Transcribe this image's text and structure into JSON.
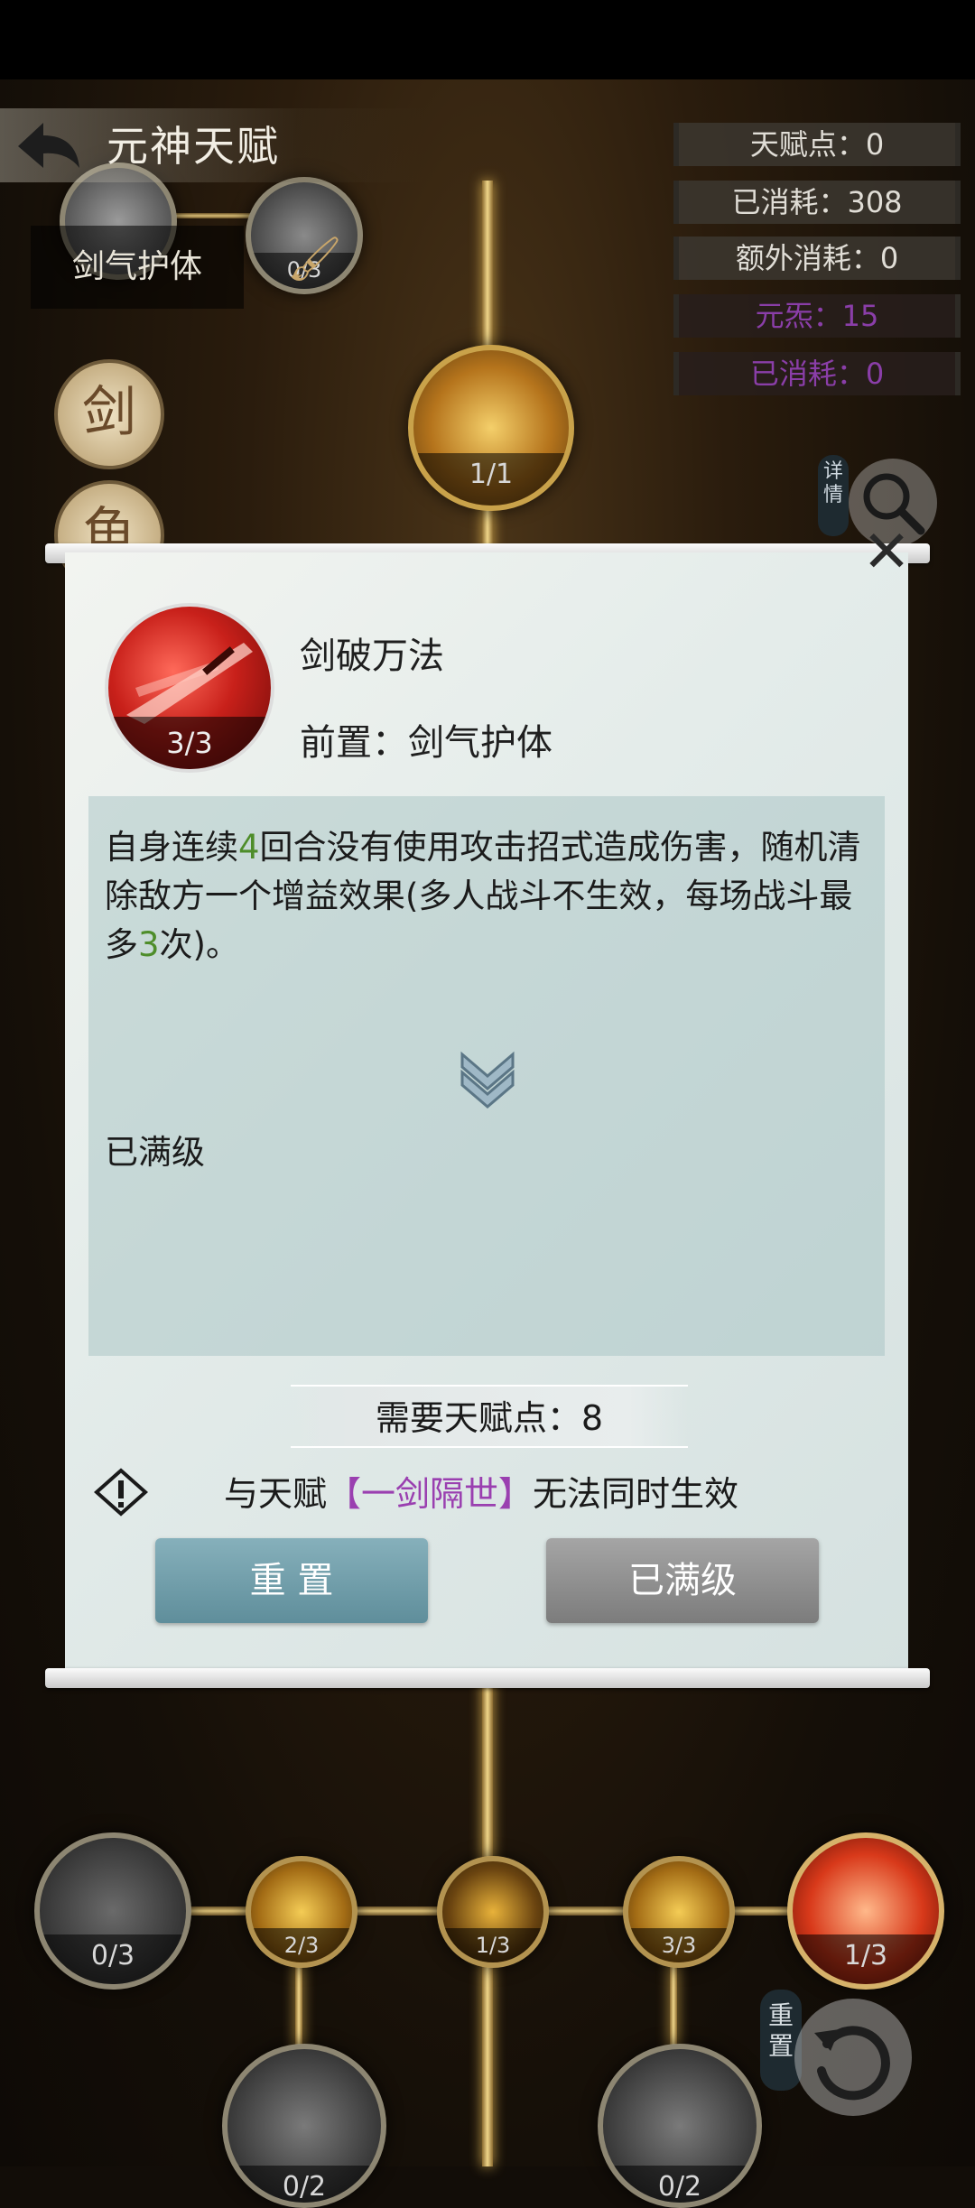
{
  "header": {
    "title": "元神天赋"
  },
  "stats": [
    {
      "label": "天赋点：0"
    },
    {
      "label": "已消耗：308"
    },
    {
      "label": "额外消耗：0"
    },
    {
      "label": "元炁：15"
    },
    {
      "label": "已消耗：0"
    }
  ],
  "tree": {
    "selected_tag": "剑气护体",
    "side_medallions": [
      "剑",
      "鱼"
    ],
    "nodes": {
      "top_right_small": "0/3",
      "center_top": "1/1",
      "bottom_row": [
        "0/3",
        "2/3",
        "1/3",
        "3/3",
        "1/3"
      ],
      "bottom_lower": [
        "0/2",
        "0/2"
      ]
    },
    "detail_badge": "详情",
    "reset_badge": "重置"
  },
  "dialog": {
    "skill_name": "剑破万法",
    "skill_level": "3/3",
    "prerequisite": "前置：剑气护体",
    "description": {
      "part1": "自身连续",
      "num1": "4",
      "part2": "回合没有使用攻击招式造成伤害，随机清除敌方一个增益效果(多人战斗不生效，每场战斗最多",
      "num2": "3",
      "part3": "次)。"
    },
    "maxed_text": "已满级",
    "cost_text": "需要天赋点：8",
    "conflict": {
      "prefix": "与天赋",
      "talent": "【一剑隔世】",
      "suffix": "无法同时生效"
    },
    "buttons": {
      "reset": "重 置",
      "maxed": "已满级"
    }
  }
}
